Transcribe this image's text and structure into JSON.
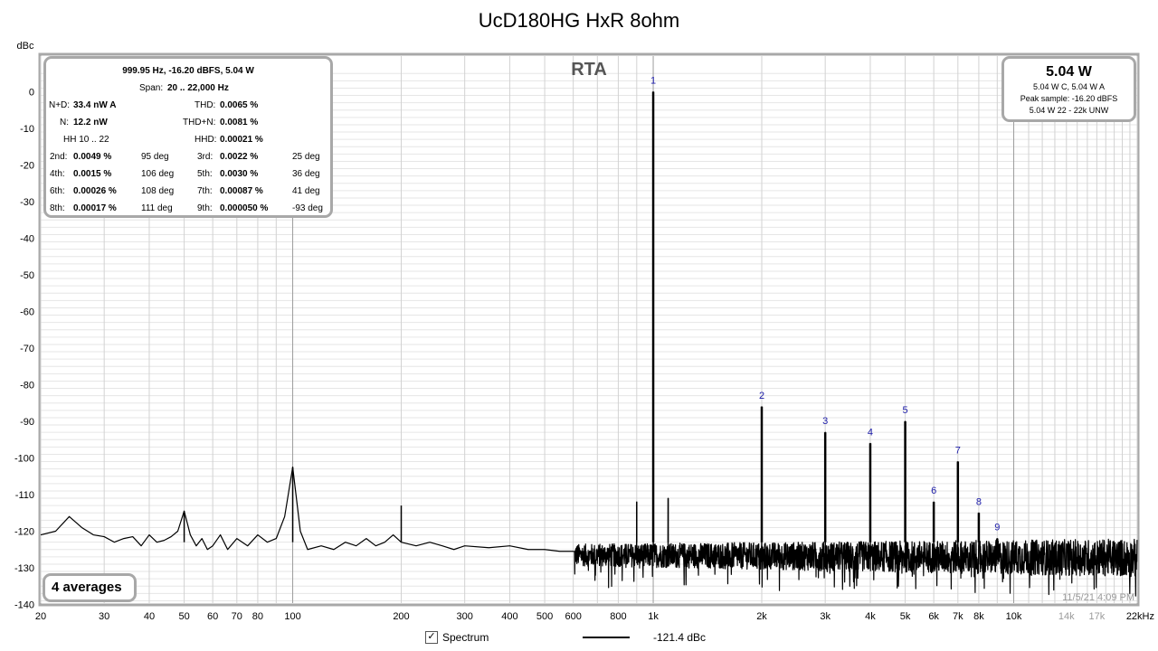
{
  "chart_data": {
    "type": "line",
    "title": "UcD180HG HxR 8ohm",
    "ylabel": "dBc",
    "xlabel": "",
    "x_scale": "log",
    "xlim": [
      20,
      22000
    ],
    "ylim": [
      -140,
      5
    ],
    "y_ticks": [
      0,
      -10,
      -20,
      -30,
      -40,
      -50,
      -60,
      -70,
      -80,
      -90,
      -100,
      -110,
      -120,
      -130,
      -140
    ],
    "x_tick_labels": [
      {
        "v": 20,
        "t": "20"
      },
      {
        "v": 30,
        "t": "30"
      },
      {
        "v": 40,
        "t": "40"
      },
      {
        "v": 50,
        "t": "50"
      },
      {
        "v": 60,
        "t": "60"
      },
      {
        "v": 70,
        "t": "70"
      },
      {
        "v": 80,
        "t": "80"
      },
      {
        "v": 100,
        "t": "100"
      },
      {
        "v": 200,
        "t": "200"
      },
      {
        "v": 300,
        "t": "300"
      },
      {
        "v": 400,
        "t": "400"
      },
      {
        "v": 500,
        "t": "500"
      },
      {
        "v": 600,
        "t": "600"
      },
      {
        "v": 800,
        "t": "800"
      },
      {
        "v": 1000,
        "t": "1k"
      },
      {
        "v": 2000,
        "t": "2k"
      },
      {
        "v": 3000,
        "t": "3k"
      },
      {
        "v": 4000,
        "t": "4k"
      },
      {
        "v": 5000,
        "t": "5k"
      },
      {
        "v": 6000,
        "t": "6k"
      },
      {
        "v": 7000,
        "t": "7k"
      },
      {
        "v": 8000,
        "t": "8k"
      },
      {
        "v": 10000,
        "t": "10k"
      },
      {
        "v": 14000,
        "t": "14k",
        "muted": true
      },
      {
        "v": 17000,
        "t": "17k",
        "muted": true
      },
      {
        "v": 22000,
        "t": "22kHz"
      }
    ],
    "grid": true,
    "panel_label": "RTA",
    "timestamp": "11/5/21 4:09 PM",
    "harmonics": [
      {
        "n": "1",
        "f": 1000,
        "db": 0
      },
      {
        "n": "2",
        "f": 2000,
        "db": -86
      },
      {
        "n": "3",
        "f": 3000,
        "db": -93
      },
      {
        "n": "4",
        "f": 4000,
        "db": -96
      },
      {
        "n": "5",
        "f": 5000,
        "db": -90
      },
      {
        "n": "6",
        "f": 6000,
        "db": -112
      },
      {
        "n": "7",
        "f": 7000,
        "db": -101
      },
      {
        "n": "8",
        "f": 8000,
        "db": -115
      },
      {
        "n": "9",
        "f": 9000,
        "db": -122
      }
    ],
    "spurs": [
      {
        "f": 100,
        "db": -102.5
      },
      {
        "f": 50,
        "db": -114.5
      },
      {
        "f": 200,
        "db": -113
      },
      {
        "f": 900,
        "db": -112
      },
      {
        "f": 1100,
        "db": -111
      }
    ],
    "noise_floor_db": -123,
    "series": [
      {
        "name": "Spectrum",
        "x": [
          20,
          22,
          24,
          26,
          28,
          30,
          32,
          34,
          36,
          38,
          40,
          42,
          44,
          46,
          48,
          50,
          52,
          54,
          56,
          58,
          60,
          63,
          66,
          70,
          75,
          80,
          85,
          90,
          95,
          100,
          105,
          110,
          120,
          130,
          140,
          150,
          160,
          170,
          180,
          190,
          200,
          220,
          240,
          260,
          280,
          300,
          350,
          400,
          450,
          500,
          550,
          600
        ],
        "y": [
          -121,
          -120,
          -116,
          -119,
          -121,
          -121.5,
          -123,
          -122,
          -121.5,
          -124,
          -121,
          -123,
          -122.5,
          -121.5,
          -120,
          -114.5,
          -121,
          -124,
          -122,
          -125,
          -124,
          -121,
          -125,
          -122,
          -124,
          -121,
          -123,
          -122,
          -116,
          -102.5,
          -120,
          -125,
          -124,
          -125,
          -123,
          -124,
          -122,
          -124,
          -123,
          -121,
          -123,
          -124,
          -123,
          -124,
          -125,
          -124,
          -124.5,
          -124,
          -125,
          -125,
          -125.5,
          -125.5
        ]
      }
    ]
  },
  "measurements": {
    "header": "999.95 Hz, -16.20 dBFS, 5.04 W",
    "span_label": "Span:",
    "span_value": "20 .. 22,000 Hz",
    "nd_label": "N+D:",
    "nd_value": "33.4 nW A",
    "thd_label": "THD:",
    "thd_value": "0.0065 %",
    "n_label": "N:",
    "n_value": "12.2 nW",
    "thdn_label": "THD+N:",
    "thdn_value": "0.0081 %",
    "hh_label": "HH 10 .. 22",
    "hhd_label": "HHD:",
    "hhd_value": "0.00021 %",
    "rows": [
      {
        "l1": "2nd:",
        "v1": "0.0049 %",
        "p1": "95 deg",
        "l2": "3rd:",
        "v2": "0.0022 %",
        "p2": "25 deg"
      },
      {
        "l1": "4th:",
        "v1": "0.0015 %",
        "p1": "106 deg",
        "l2": "5th:",
        "v2": "0.0030 %",
        "p2": "36 deg"
      },
      {
        "l1": "6th:",
        "v1": "0.00026 %",
        "p1": "108 deg",
        "l2": "7th:",
        "v2": "0.00087 %",
        "p2": "41 deg"
      },
      {
        "l1": "8th:",
        "v1": "0.00017 %",
        "p1": "111 deg",
        "l2": "9th:",
        "v2": "0.000050 %",
        "p2": "-93 deg"
      }
    ]
  },
  "level": {
    "main": "5.04 W",
    "line1": "5.04 W C, 5.04 W A",
    "line2": "Peak sample: -16.20 dBFS",
    "line3": "5.04 W 22 - 22k UNW"
  },
  "averages_label": "4 averages",
  "footer": {
    "check_mark": "✓",
    "spectrum_label": "Spectrum",
    "legend_value": "-121.4 dBc"
  },
  "colors": {
    "trace": "#000000",
    "harmonic_label": "#1a1aa8",
    "grid": "#d2d2d2",
    "grid_minor": "#e6e6e6",
    "frame": "#a8a8a8",
    "decade_line": "#9c9c9c"
  }
}
